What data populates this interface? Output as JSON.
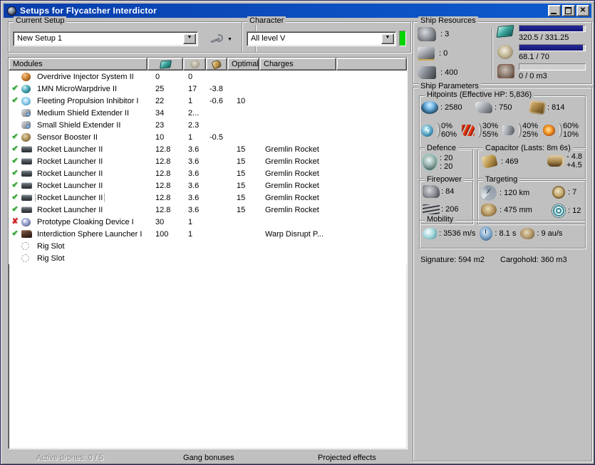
{
  "window": {
    "title": "Setups for Flycatcher Interdictor"
  },
  "setup": {
    "label": "Current Setup",
    "value": "New Setup 1"
  },
  "character": {
    "label": "Character",
    "value": "All level V"
  },
  "table": {
    "headers": {
      "modules": "Modules",
      "optimal": "Optimal",
      "charges": "Charges"
    },
    "rows": [
      {
        "status": "none",
        "icon": "overdrive",
        "name": "Overdrive Injector System II",
        "cpu": "0",
        "pg": "0",
        "cap": "",
        "optimal": "",
        "charge": "",
        "focused": false
      },
      {
        "status": "ok",
        "icon": "mwd",
        "name": "1MN MicroWarpdrive II",
        "cpu": "25",
        "pg": "17",
        "cap": "-3.8",
        "optimal": "",
        "charge": "",
        "focused": false
      },
      {
        "status": "ok",
        "icon": "web",
        "name": "Fleeting Propulsion Inhibitor I",
        "cpu": "22",
        "pg": "1",
        "cap": "-0.6",
        "optimal": "10",
        "charge": "",
        "focused": false
      },
      {
        "status": "none",
        "icon": "shield",
        "name": "Medium Shield Extender II",
        "cpu": "34",
        "pg": "2...",
        "cap": "",
        "optimal": "",
        "charge": "",
        "focused": false
      },
      {
        "status": "none",
        "icon": "shield",
        "name": "Small Shield Extender II",
        "cpu": "23",
        "pg": "2.3",
        "cap": "",
        "optimal": "",
        "charge": "",
        "focused": false
      },
      {
        "status": "ok",
        "icon": "sensor",
        "name": "Sensor Booster II",
        "cpu": "10",
        "pg": "1",
        "cap": "-0.5",
        "optimal": "",
        "charge": "",
        "focused": false
      },
      {
        "status": "ok",
        "icon": "rocket",
        "name": "Rocket Launcher II",
        "cpu": "12.8",
        "pg": "3.6",
        "cap": "",
        "optimal": "15",
        "charge": "Gremlin Rocket",
        "focused": false
      },
      {
        "status": "ok",
        "icon": "rocket",
        "name": "Rocket Launcher II",
        "cpu": "12.8",
        "pg": "3.6",
        "cap": "",
        "optimal": "15",
        "charge": "Gremlin Rocket",
        "focused": false
      },
      {
        "status": "ok",
        "icon": "rocket",
        "name": "Rocket Launcher II",
        "cpu": "12.8",
        "pg": "3.6",
        "cap": "",
        "optimal": "15",
        "charge": "Gremlin Rocket",
        "focused": false
      },
      {
        "status": "ok",
        "icon": "rocket",
        "name": "Rocket Launcher II",
        "cpu": "12.8",
        "pg": "3.6",
        "cap": "",
        "optimal": "15",
        "charge": "Gremlin Rocket",
        "focused": false
      },
      {
        "status": "ok",
        "icon": "rocket",
        "name": "Rocket Launcher II",
        "cpu": "12.8",
        "pg": "3.6",
        "cap": "",
        "optimal": "15",
        "charge": "Gremlin Rocket",
        "focused": true
      },
      {
        "status": "ok",
        "icon": "rocket",
        "name": "Rocket Launcher II",
        "cpu": "12.8",
        "pg": "3.6",
        "cap": "",
        "optimal": "15",
        "charge": "Gremlin Rocket",
        "focused": false
      },
      {
        "status": "bad",
        "icon": "cloak",
        "name": "Prototype Cloaking Device I",
        "cpu": "30",
        "pg": "1",
        "cap": "",
        "optimal": "",
        "charge": "",
        "focused": false
      },
      {
        "status": "ok",
        "icon": "dictor",
        "name": "Interdiction Sphere Launcher I",
        "cpu": "100",
        "pg": "1",
        "cap": "",
        "optimal": "",
        "charge": "Warp Disrupt P...",
        "focused": false
      },
      {
        "status": "none",
        "icon": "rig",
        "name": "Rig Slot",
        "cpu": "",
        "pg": "",
        "cap": "",
        "optimal": "",
        "charge": "",
        "focused": false
      },
      {
        "status": "none",
        "icon": "rig",
        "name": "Rig Slot",
        "cpu": "",
        "pg": "",
        "cap": "",
        "optimal": "",
        "charge": "",
        "focused": false
      }
    ]
  },
  "footer": {
    "active_drones": "Active drones: 0 / 5",
    "gang_bonuses": "Gang bonuses",
    "projected_effects": "Projected effects"
  },
  "ship_resources": {
    "title": "Ship Resources",
    "slots": [
      {
        "icon": "turret-hardpoint",
        "value": ": 3"
      },
      {
        "icon": "launcher-hardpoint",
        "value": ": 0"
      },
      {
        "icon": "calibration",
        "value": ": 400"
      }
    ],
    "bars": [
      {
        "icon": "cpu",
        "text": "320.5 / 331.25",
        "pct": 97
      },
      {
        "icon": "powergrid",
        "text": "68.1 / 70",
        "pct": 97
      },
      {
        "icon": "dronebay",
        "text": "0 / 0 m3",
        "pct": 0
      }
    ]
  },
  "ship_parameters": {
    "title": "Ship Parameters",
    "hitpoints": {
      "title": "Hitpoints (Effective HP: 5,836)",
      "pools": [
        {
          "icon": "shield",
          "value": ": 2580"
        },
        {
          "icon": "armor",
          "value": ": 750"
        },
        {
          "icon": "structure",
          "value": ": 814"
        }
      ],
      "resists": [
        {
          "icon": "em",
          "shield": "0%",
          "armor": "60%"
        },
        {
          "icon": "thermal",
          "shield": "30%",
          "armor": "55%"
        },
        {
          "icon": "kinetic",
          "shield": "40%",
          "armor": "25%"
        },
        {
          "icon": "explosive",
          "shield": "60%",
          "armor": "10%"
        }
      ]
    },
    "defence": {
      "title": "Defence",
      "value_top": ": 20",
      "value_bottom": ": 20"
    },
    "capacitor": {
      "title": "Capacitor (Lasts: 8m 6s)",
      "amount": ": 469",
      "minus": "- 4.8",
      "plus": "+4.5"
    },
    "firepower": {
      "title": "Firepower",
      "turret": ": 84",
      "missile": ": 206"
    },
    "targeting": {
      "title": "Targeting",
      "range": ": 120 km",
      "sig_resolution": ": 475 mm",
      "scan_strength": ": 7",
      "max_targets": ": 12"
    },
    "mobility": {
      "title": "Mobility",
      "speed": ": 3536 m/s",
      "align_time": ": 8.1 s",
      "warp_speed": ": 9 au/s"
    },
    "signature": "Signature: 594 m2",
    "cargohold": "Cargohold: 360 m3"
  }
}
